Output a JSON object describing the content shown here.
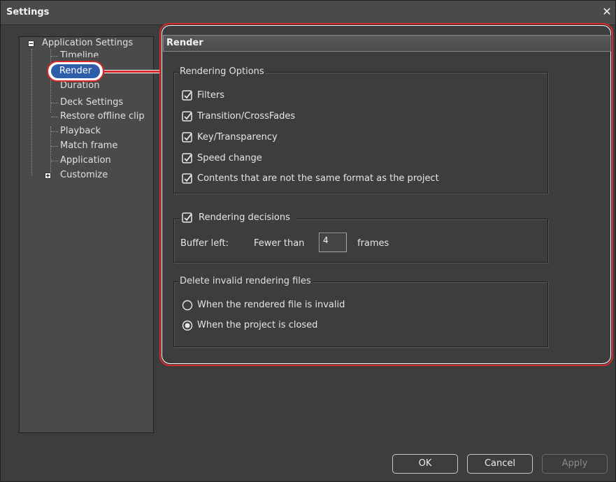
{
  "window": {
    "title": "Settings",
    "close_glyph": "✕"
  },
  "tree": {
    "root_label": "Application Settings",
    "items": [
      "Timeline",
      "Render",
      "Duration",
      "Deck Settings",
      "Restore offline clip",
      "Playback",
      "Match frame",
      "Application"
    ],
    "selected_label": "Render",
    "customize_label": "Customize"
  },
  "panel": {
    "title": "Render"
  },
  "rendering_options": {
    "legend": "Rendering Options",
    "options": [
      {
        "label": "Filters",
        "checked": true
      },
      {
        "label": "Transition/CrossFades",
        "checked": true
      },
      {
        "label": "Key/Transparency",
        "checked": true
      },
      {
        "label": "Speed change",
        "checked": true
      },
      {
        "label": "Contents that are not the same format as the project",
        "checked": true
      }
    ]
  },
  "rendering_decisions": {
    "legend": "Rendering decisions",
    "checked": true,
    "buffer_label": "Buffer left:",
    "fewer_than_label": "Fewer than",
    "buffer_value": "4",
    "frames_label": "frames"
  },
  "delete_invalid": {
    "legend": "Delete invalid rendering files",
    "options": [
      {
        "label": "When the rendered file is invalid",
        "selected": false
      },
      {
        "label": "When the project is closed",
        "selected": true
      }
    ]
  },
  "buttons": {
    "ok": "OK",
    "cancel": "Cancel",
    "apply": "Apply"
  },
  "colors": {
    "highlight": "#d42a2a",
    "selection": "#2f5ea8",
    "background": "#3d3d3d"
  }
}
